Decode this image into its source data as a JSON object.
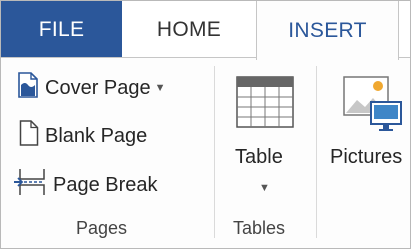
{
  "tabs": [
    {
      "label": "FILE"
    },
    {
      "label": "HOME"
    },
    {
      "label": "INSERT"
    }
  ],
  "pages_group": {
    "label": "Pages",
    "cover_page": "Cover Page",
    "blank_page": "Blank Page",
    "page_break": "Page Break"
  },
  "tables_group": {
    "label": "Tables",
    "table": "Table"
  },
  "illustrations": {
    "pictures": "Pictures"
  },
  "colors": {
    "file_tab": "#2b579a",
    "accent": "#2b579a"
  },
  "icons": [
    "cover-page-icon",
    "blank-page-icon",
    "page-break-icon",
    "table-icon",
    "pictures-icon",
    "dropdown-caret-icon"
  ]
}
